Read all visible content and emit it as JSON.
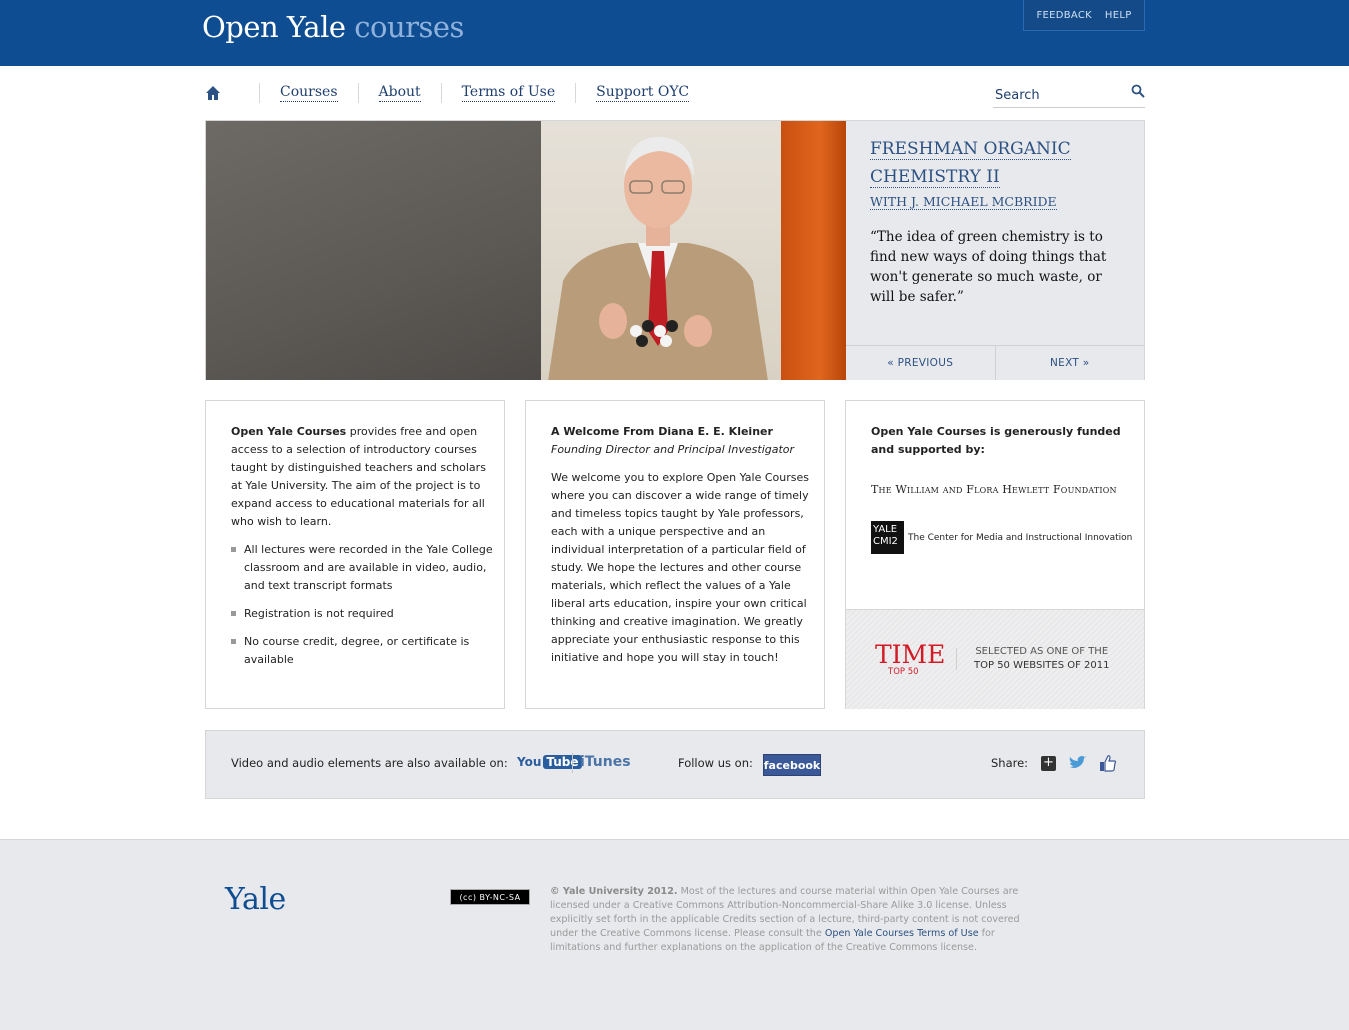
{
  "header": {
    "logo_main": "Open Yale",
    "logo_accent": "courses",
    "feedback": "FEEDBACK",
    "help": "HELP"
  },
  "nav": {
    "items": [
      "Courses",
      "About",
      "Terms of Use",
      "Support OYC"
    ],
    "search_placeholder": "Search"
  },
  "hero": {
    "title_line1": "FRESHMAN ORGANIC",
    "title_line2": "CHEMISTRY II",
    "subtitle": "WITH J. MICHAEL MCBRIDE",
    "quote": "“The idea of green chemistry is to find new ways of doing things that won't generate so much waste, or will be safer.”",
    "previous": "« PREVIOUS",
    "next": "NEXT »"
  },
  "intro": {
    "lead_bold": "Open Yale Courses",
    "lead_rest": " provides free and open access to a selection of introductory courses taught by distinguished teachers and scholars at Yale University. The aim of the project is to expand access to educational materials for all who wish to learn.",
    "bullets": [
      "All lectures were recorded in the Yale College classroom and are available in video, audio, and text transcript formats",
      "Registration is not required",
      "No course credit, degree, or certificate is available"
    ]
  },
  "welcome": {
    "heading": "A Welcome From Diana E. E. Kleiner",
    "role": "Founding Director and Principal Investigator",
    "body": "We welcome you to explore Open Yale Courses where you can discover a wide range of timely and timeless topics taught by Yale professors, each with a unique perspective and an individual interpretation of a particular field of study. We hope the lectures and other course materials, which reflect the values of a Yale liberal arts education, inspire your own critical thinking and creative imagination. We greatly appreciate your enthusiastic response to this initiative and hope you will stay in touch!"
  },
  "sponsors": {
    "heading": "Open Yale Courses is generously funded and supported by:",
    "hewlett": "The William and Flora Hewlett Foundation",
    "cmi_logo_top": "YALE",
    "cmi_logo_bottom": "CMI2",
    "cmi_text": "The Center for Media and Instructional Innovation",
    "time_logo": "TIME",
    "time_top": "TOP 50",
    "time_line1": "SELECTED AS ONE OF THE",
    "time_line2": "TOP 50 WEBSITES OF 2011"
  },
  "media": {
    "available_text": "Video and audio elements are also available on:",
    "youtube_you": "You",
    "youtube_tube": "Tube",
    "itunes": "iTunes",
    "follow": "Follow us on:",
    "facebook": "facebook",
    "share": "Share:"
  },
  "footer": {
    "yale": "Yale",
    "cc_badge": "(cc) BY-NC-SA",
    "copyright_bold": "© Yale University 2012.",
    "legal_text": " Most of the lectures and course material within Open Yale Courses are licensed under a Creative Commons Attribution-Noncommercial-Share Alike 3.0 license. Unless explicitly set forth in the applicable Credits section of a lecture, third-party content is not covered under the Creative Commons license. Please consult the ",
    "legal_link": "Open Yale Courses Terms of Use",
    "legal_tail": " for limitations and further explanations on the application of the Creative Commons license."
  },
  "colors": {
    "brand_blue": "#0f4d92",
    "link_blue": "#2c5183",
    "time_red": "#d21b24",
    "facebook_blue": "#3b5998"
  }
}
